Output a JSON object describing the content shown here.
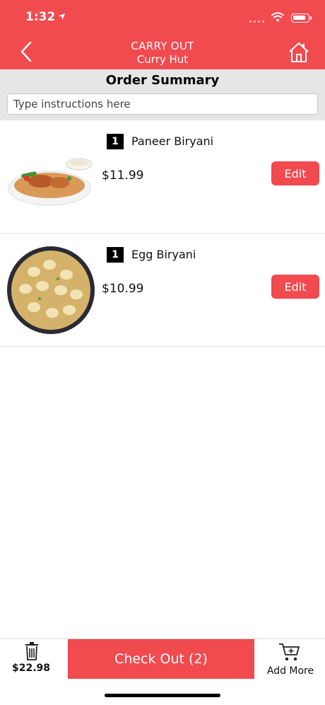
{
  "status": {
    "time": "1:32"
  },
  "header": {
    "mode": "CARRY OUT",
    "store": "Curry Hut"
  },
  "summary": {
    "title": "Order Summary",
    "instructions_placeholder": "Type instructions here"
  },
  "items": [
    {
      "qty": "1",
      "name": "Paneer Biryani",
      "price": "$11.99",
      "edit_label": "Edit"
    },
    {
      "qty": "1",
      "name": "Egg Biryani",
      "price": "$10.99",
      "edit_label": "Edit"
    }
  ],
  "footer": {
    "total": "$22.98",
    "checkout_label": "Check Out (2)",
    "add_more_label": "Add More"
  },
  "colors": {
    "accent": "#f14a4f",
    "summary_bg": "#e6e6e6"
  },
  "icons": [
    "location-arrow-icon",
    "wifi-icon",
    "battery-icon",
    "back-chevron-icon",
    "home-icon",
    "trash-icon",
    "cart-plus-icon"
  ]
}
